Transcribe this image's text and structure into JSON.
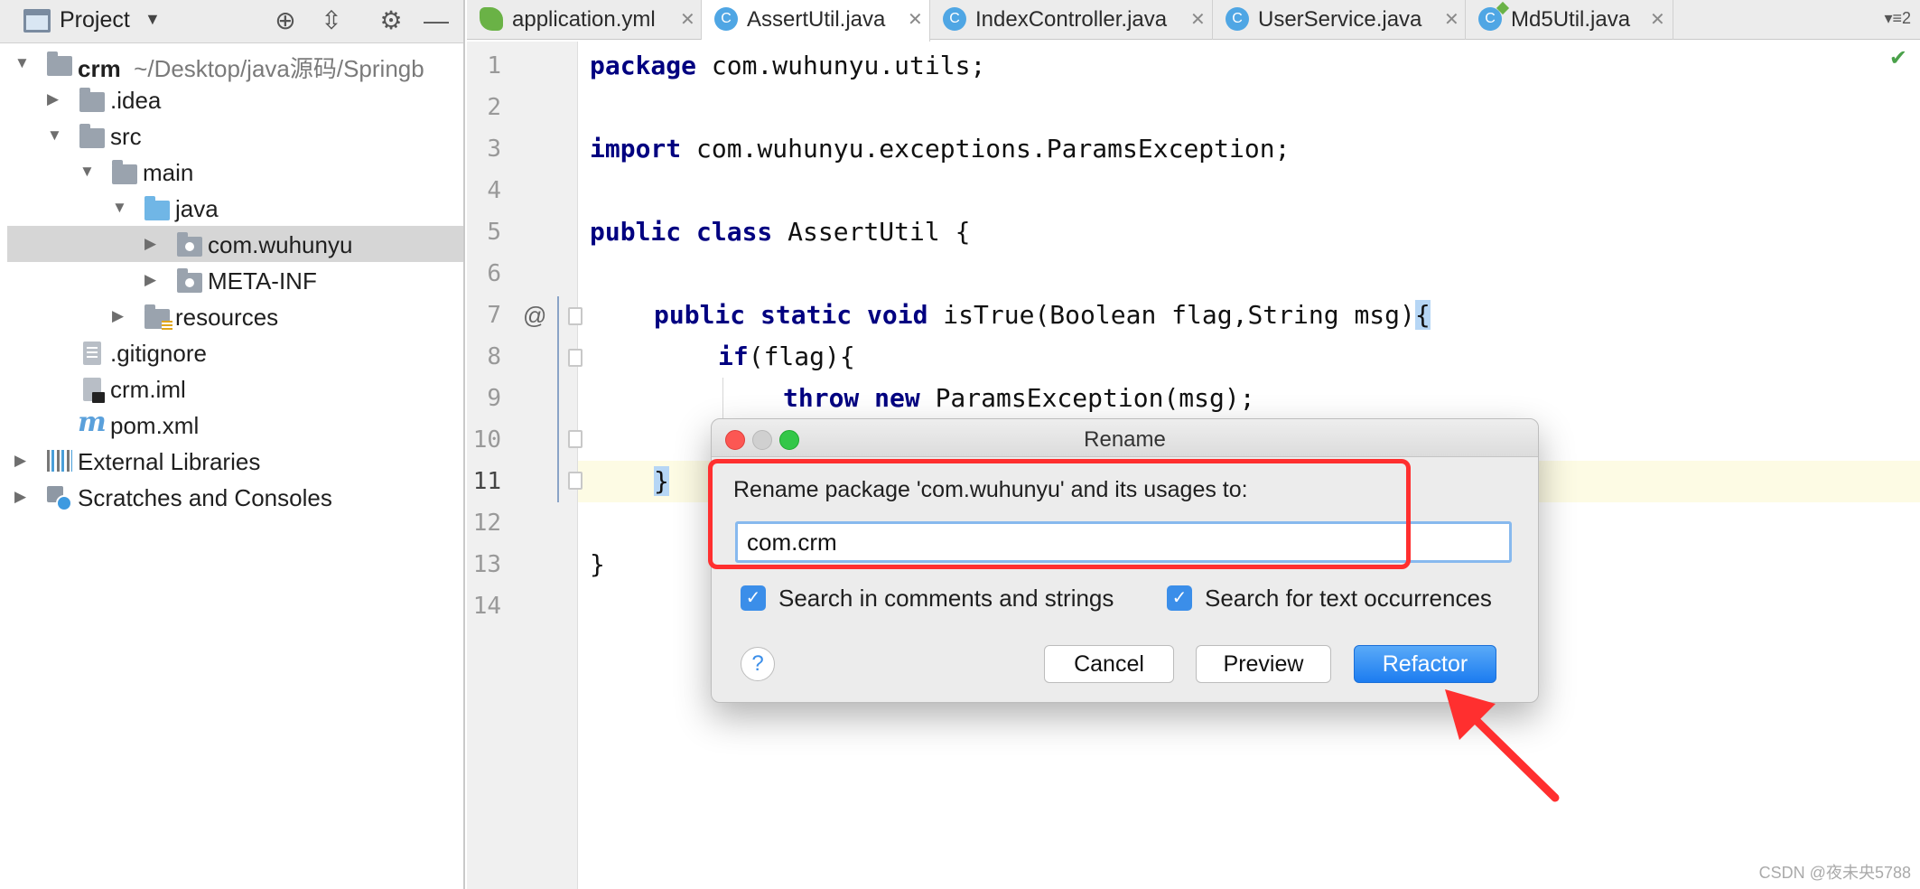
{
  "project_panel": {
    "title": "Project",
    "tree": [
      {
        "name": "crm",
        "sub": "~/Desktop/java源码/Springb"
      },
      {
        "name": ".idea"
      },
      {
        "name": "src"
      },
      {
        "name": "main"
      },
      {
        "name": "java"
      },
      {
        "name": "com.wuhunyu"
      },
      {
        "name": "META-INF"
      },
      {
        "name": "resources"
      },
      {
        "name": ".gitignore"
      },
      {
        "name": "crm.iml"
      },
      {
        "name": "pom.xml"
      },
      {
        "name": "External Libraries"
      },
      {
        "name": "Scratches and Consoles"
      }
    ]
  },
  "tabs": [
    {
      "label": "application.yml"
    },
    {
      "label": "AssertUtil.java"
    },
    {
      "label": "IndexController.java"
    },
    {
      "label": "UserService.java"
    },
    {
      "label": "Md5Util.java"
    }
  ],
  "tab_overflow": "2",
  "editor": {
    "line_numbers": [
      "1",
      "2",
      "3",
      "4",
      "5",
      "6",
      "7",
      "8",
      "9",
      "10",
      "11",
      "12",
      "13",
      "14"
    ],
    "lines": {
      "l1_kw": "package",
      "l1_rest": " com.wuhunyu.utils;",
      "l3_kw": "import",
      "l3_rest": " com.wuhunyu.exceptions.ParamsException;",
      "l5_kw": "public class",
      "l5_rest": " AssertUtil {",
      "l7_kw": "public static void",
      "l7_rest": " isTrue(Boolean flag,String msg)",
      "l7_brace": "{",
      "l8_kw": "if",
      "l8_rest": "(flag){",
      "l9_kw": "throw new",
      "l9_rest": " ParamsException(msg);",
      "l11_brace": "}",
      "l13": "}"
    },
    "annotation": "@"
  },
  "dialog": {
    "title": "Rename",
    "label": "Rename package 'com.wuhunyu' and its usages to:",
    "input_value": "com.crm",
    "check_comments": "Search in comments and strings",
    "check_text": "Search for text occurrences",
    "help": "?",
    "cancel": "Cancel",
    "preview": "Preview",
    "refactor": "Refactor"
  },
  "colors": {
    "keyword": "#000080",
    "accent": "#1c7cf0",
    "annotation_red": "#ff2f2f"
  },
  "watermark": "CSDN @夜未央5788"
}
